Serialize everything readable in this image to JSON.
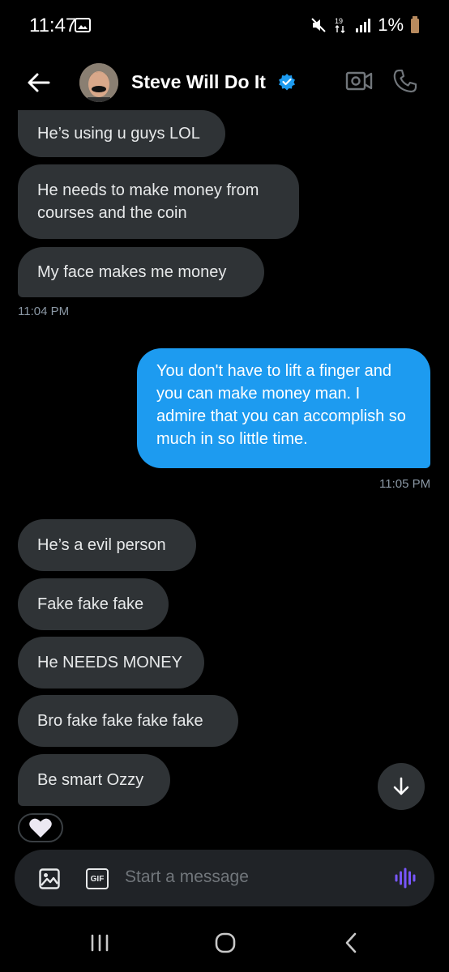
{
  "status": {
    "time": "11:47",
    "battery": "1%",
    "network": "19 K/s"
  },
  "header": {
    "name": "Steve Will Do It"
  },
  "messages": [
    {
      "text": "He’s using u guys LOL"
    },
    {
      "text": "He needs to make money from courses and the coin"
    },
    {
      "text": "My face makes me money"
    },
    {
      "text": "You don't have to lift a finger and you can make money man. I admire that you can accomplish so much in so little time."
    },
    {
      "text": "He’s a evil person"
    },
    {
      "text": "Fake fake fake"
    },
    {
      "text": "He NEEDS MONEY"
    },
    {
      "text": "Bro fake fake fake fake"
    },
    {
      "text": "Be smart Ozzy"
    }
  ],
  "timestamps": [
    "11:04 PM",
    "11:05 PM"
  ],
  "composer": {
    "placeholder": "Start a message",
    "gif_label": "GIF"
  },
  "colors": {
    "outgoing_bubble": "#1d9bf0",
    "incoming_bubble": "#2f3336",
    "voice_icon": "#7856ff"
  }
}
